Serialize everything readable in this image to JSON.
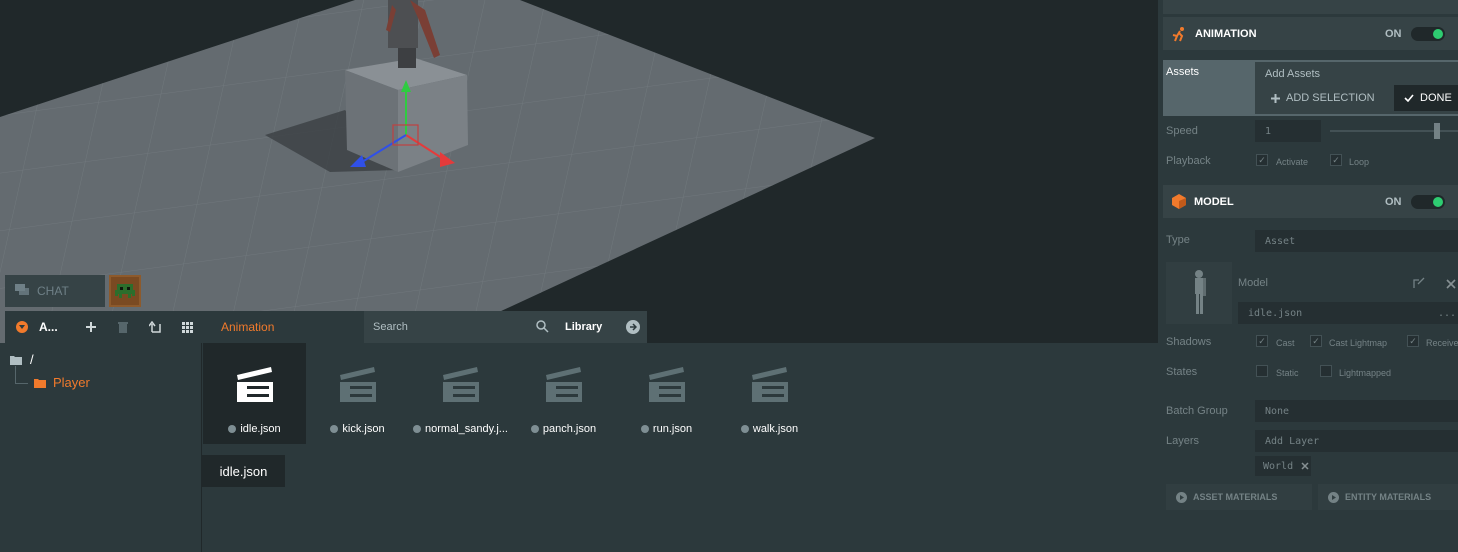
{
  "colors": {
    "accent": "#f17a2c",
    "panel": "#2c393c",
    "panel_dark": "#20282a",
    "toggle_on": "#2ecc71"
  },
  "chat": {
    "label": "CHAT"
  },
  "assets_panel": {
    "title": "A...",
    "toolbar_icons": [
      "add-icon",
      "delete-icon",
      "move-up-icon",
      "grid-view-icon"
    ],
    "tabs": {
      "active": "Animation",
      "search_placeholder": "Search",
      "library": "Library"
    },
    "tree": {
      "root": "/",
      "folder": "Player"
    },
    "items": [
      {
        "name": "idle.json",
        "selected": true
      },
      {
        "name": "kick.json",
        "selected": false
      },
      {
        "name": "normal_sandy.j...",
        "selected": false
      },
      {
        "name": "panch.json",
        "selected": false
      },
      {
        "name": "run.json",
        "selected": false
      },
      {
        "name": "walk.json",
        "selected": false
      }
    ],
    "tooltip": "idle.json"
  },
  "inspector": {
    "animation": {
      "title": "ANIMATION",
      "state": "ON",
      "assets_label": "Assets",
      "add_assets_placeholder": "Add Assets",
      "add_selection": "ADD SELECTION",
      "done": "DONE",
      "speed_label": "Speed",
      "speed_value": "1",
      "speed_fraction": 0.85,
      "playback_label": "Playback",
      "activate": "Activate",
      "loop": "Loop"
    },
    "model": {
      "title": "MODEL",
      "state": "ON",
      "type_label": "Type",
      "type_value": "Asset",
      "model_label": "Model",
      "model_asset": "idle.json",
      "model_more": "...",
      "shadows_label": "Shadows",
      "cast": "Cast",
      "cast_lightmap": "Cast Lightmap",
      "receive": "Receive",
      "states_label": "States",
      "static": "Static",
      "lightmapped": "Lightmapped",
      "batch_group_label": "Batch Group",
      "batch_group_value": "None",
      "layers_label": "Layers",
      "add_layer_placeholder": "Add Layer",
      "layer_tag": "World",
      "asset_materials": "ASSET MATERIALS",
      "entity_materials": "ENTITY MATERIALS"
    }
  }
}
